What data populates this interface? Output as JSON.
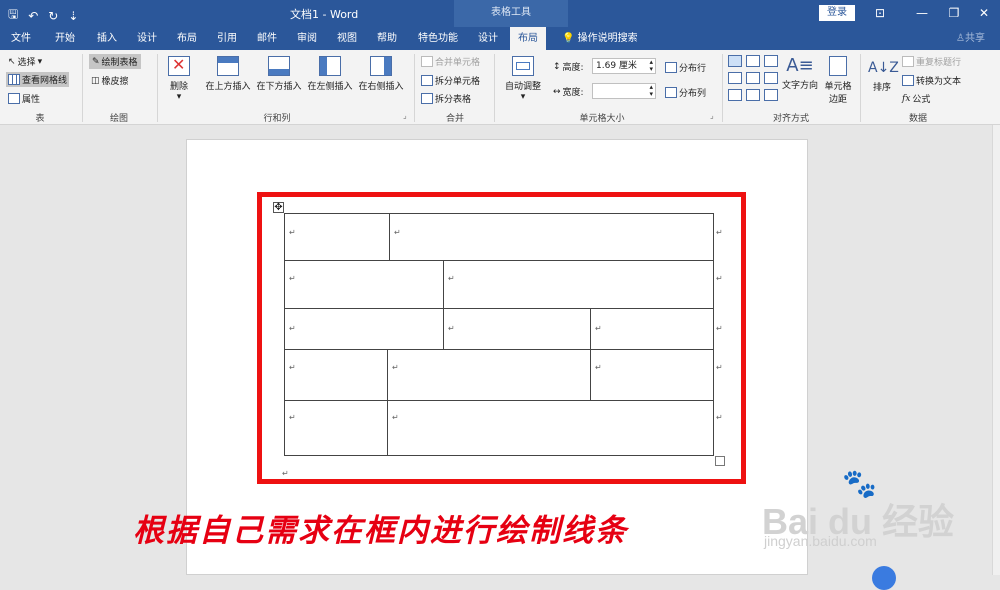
{
  "titlebar": {
    "doc_title": "文档1  -  Word",
    "context_tab": "表格工具",
    "login": "登录",
    "qat": {
      "save": "🖫",
      "undo": "↶",
      "redo": "↻",
      "more": "⇣"
    },
    "window": {
      "ribbon_opts": "⊡",
      "minimize": "—",
      "restore": "❐",
      "close": "✕"
    }
  },
  "tabs": [
    "文件",
    "开始",
    "插入",
    "设计",
    "布局",
    "引用",
    "邮件",
    "审阅",
    "视图",
    "帮助",
    "特色功能",
    "设计",
    "布局"
  ],
  "active_tab_index": 12,
  "search_label": "操作说明搜索",
  "share_label": "共享",
  "ribbon": {
    "table_group": {
      "label": "表",
      "select": "选择",
      "view_gridlines": "查看网格线",
      "properties": "属性"
    },
    "draw_group": {
      "label": "绘图",
      "draw_table": "绘制表格",
      "eraser": "橡皮擦"
    },
    "rows_cols_group": {
      "label": "行和列",
      "delete": "删除",
      "insert_above": "在上方插入",
      "insert_below": "在下方插入",
      "insert_left": "在左侧插入",
      "insert_right": "在右侧插入"
    },
    "merge_group": {
      "label": "合并",
      "merge_cells": "合并单元格",
      "split_cells": "拆分单元格",
      "split_table": "拆分表格"
    },
    "cell_size_group": {
      "label": "单元格大小",
      "autofit": "自动调整",
      "height_label": "高度:",
      "height_value": "1.69 厘米",
      "width_label": "宽度:",
      "width_value": "",
      "distribute_rows": "分布行",
      "distribute_cols": "分布列"
    },
    "alignment_group": {
      "label": "对齐方式",
      "text_direction": "文字方向",
      "cell_margins_1": "单元格",
      "cell_margins_2": "边距"
    },
    "data_group": {
      "label": "数据",
      "sort": "排序",
      "repeat_header": "重复标题行",
      "convert_to_text": "转换为文本",
      "formula": "公式"
    }
  },
  "document": {
    "paragraph_mark": "↵",
    "table_move_handle": "✥",
    "caption": "根据自己需求在框内进行绘制线条"
  },
  "watermark": {
    "main": "Bai du 经验",
    "sub": "jingyan.baidu.com"
  }
}
